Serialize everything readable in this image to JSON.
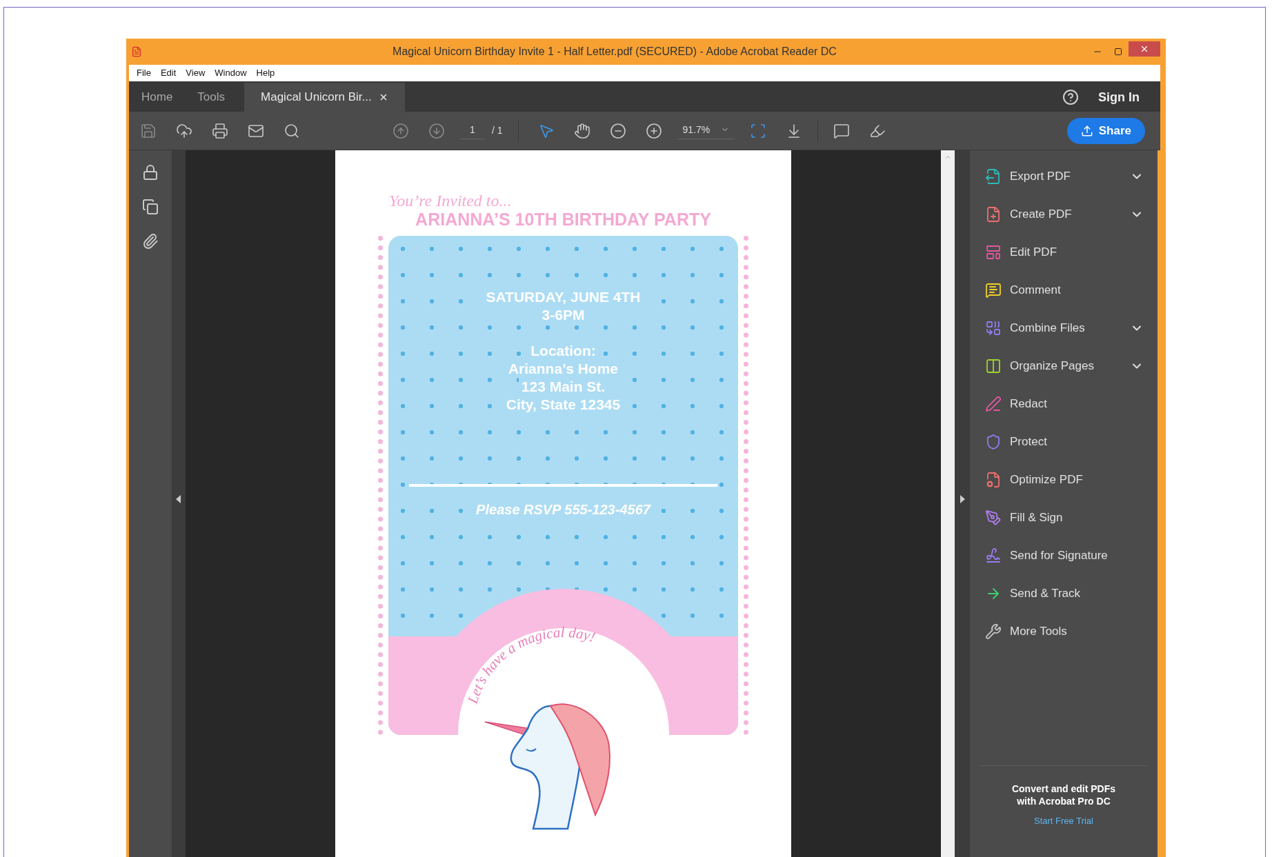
{
  "window": {
    "title": "Magical Unicorn Birthday Invite 1 - Half Letter.pdf (SECURED) - Adobe Acrobat Reader DC"
  },
  "menu": [
    "File",
    "Edit",
    "View",
    "Window",
    "Help"
  ],
  "tabs": [
    {
      "label": "Home",
      "selected": false,
      "closable": false
    },
    {
      "label": "Tools",
      "selected": false,
      "closable": false
    },
    {
      "label": "Magical Unicorn Bir...",
      "selected": true,
      "closable": true
    }
  ],
  "account": {
    "sign_in": "Sign In"
  },
  "toolbar": {
    "page": "1",
    "page_total": "/ 1",
    "zoom": "91.7%",
    "share": "Share"
  },
  "document": {
    "script_heading": "You’re Invited to...",
    "title": "ARIANNA’S 10TH BIRTHDAY PARTY",
    "blocks": [
      [
        "SATURDAY, JUNE 4TH",
        "3-6PM"
      ],
      [
        "Location:",
        "Arianna’s Home",
        "123 Main St.",
        "City, State 12345"
      ]
    ],
    "rsvp": "Please RSVP 555-123-4567",
    "arc_text": "Let’s have a magical day!"
  },
  "tools": [
    {
      "label": "Export PDF",
      "color": "#2fb7b7",
      "expandable": true
    },
    {
      "label": "Create PDF",
      "color": "#ef6f6f",
      "expandable": true
    },
    {
      "label": "Edit PDF",
      "color": "#e2579f",
      "expandable": false
    },
    {
      "label": "Comment",
      "color": "#f0cf2a",
      "expandable": false
    },
    {
      "label": "Combine Files",
      "color": "#8c7df0",
      "expandable": true
    },
    {
      "label": "Organize Pages",
      "color": "#9fd42a",
      "expandable": true
    },
    {
      "label": "Redact",
      "color": "#e2579f",
      "expandable": false
    },
    {
      "label": "Protect",
      "color": "#8c7df0",
      "expandable": false
    },
    {
      "label": "Optimize PDF",
      "color": "#ef6f6f",
      "expandable": false
    },
    {
      "label": "Fill & Sign",
      "color": "#b07cf0",
      "expandable": false
    },
    {
      "label": "Send for Signature",
      "color": "#9b7cf0",
      "expandable": false
    },
    {
      "label": "Send & Track",
      "color": "#3fcf6b",
      "expandable": false
    },
    {
      "label": "More Tools",
      "color": "#c8c8c8",
      "expandable": false
    }
  ],
  "promo": {
    "lines": [
      "Convert and edit PDFs",
      "with Acrobat Pro DC"
    ],
    "link": "Start Free Trial"
  }
}
